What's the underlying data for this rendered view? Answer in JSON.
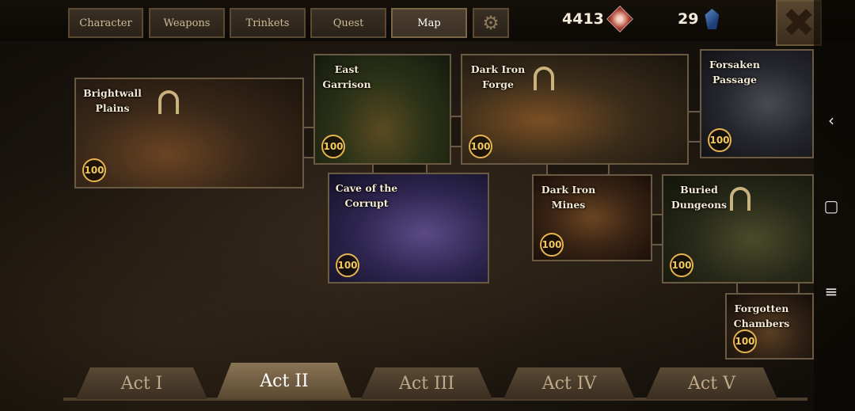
{
  "tabs": [
    {
      "label": "Character",
      "active": false
    },
    {
      "label": "Weapons",
      "active": false
    },
    {
      "label": "Trinkets",
      "active": false
    },
    {
      "label": "Quest",
      "active": false
    },
    {
      "label": "Map",
      "active": true
    }
  ],
  "currency": {
    "primary": "4413",
    "premium": "29"
  },
  "nodes": [
    {
      "name": "Brightwall Plains",
      "cost": "100"
    },
    {
      "name": "East Garrison",
      "cost": "100"
    },
    {
      "name": "Dark Iron Forge",
      "cost": "100"
    },
    {
      "name": "Forsaken Passage",
      "cost": "100"
    },
    {
      "name": "Cave of the Corrupt",
      "cost": "100"
    },
    {
      "name": "Dark Iron Mines",
      "cost": "100"
    },
    {
      "name": "Buried Dungeons",
      "cost": "100"
    },
    {
      "name": "Forgotten Chambers",
      "cost": "100"
    }
  ],
  "acts": [
    {
      "label": "Act I",
      "active": false
    },
    {
      "label": "Act II",
      "active": true
    },
    {
      "label": "Act III",
      "active": false
    },
    {
      "label": "Act IV",
      "active": false
    },
    {
      "label": "Act V",
      "active": false
    }
  ],
  "icons": {
    "settings": "gear-icon",
    "close": "close-icon",
    "back": "chevron-left-icon",
    "home": "square-icon",
    "menu": "menu-icon"
  }
}
